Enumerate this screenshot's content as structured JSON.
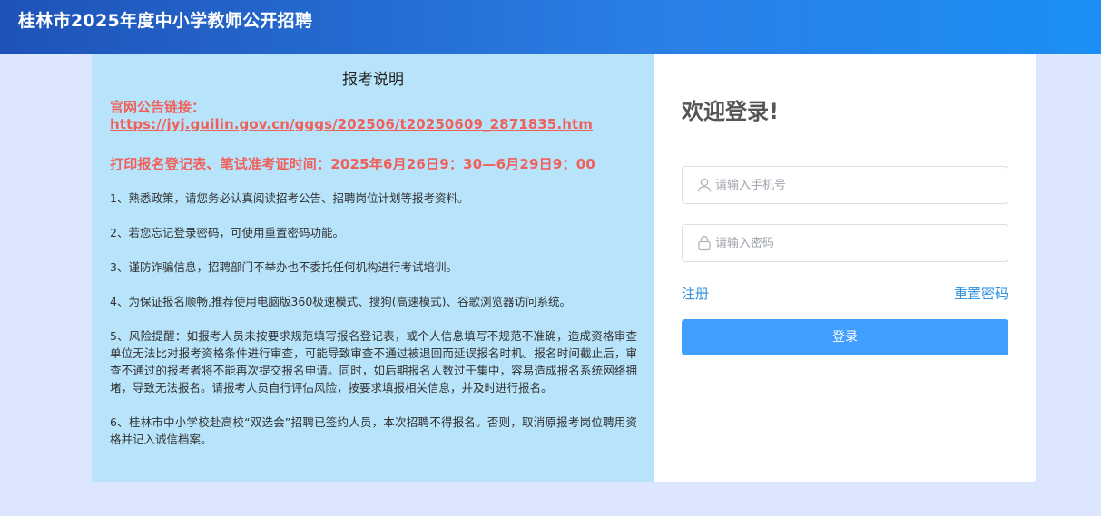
{
  "header": {
    "title": "桂林市2025年度中小学教师公开招聘"
  },
  "notice": {
    "title": "报考说明",
    "link_label": "官网公告链接：",
    "link_url": "https://jyj.guilin.gov.cn/gggs/202506/t20250609_2871835.htm",
    "time": "打印报名登记表、笔试准考证时间：2025年6月26日9：30—6月29日9：00",
    "items": [
      "1、熟悉政策，请您务必认真阅读招考公告、招聘岗位计划等报考资料。",
      "2、若您忘记登录密码，可使用重置密码功能。",
      "3、谨防诈骗信息，招聘部门不举办也不委托任何机构进行考试培训。",
      "4、为保证报名顺畅,推荐使用电脑版360极速模式、搜狗(高速模式)、谷歌浏览器访问系统。",
      "5、风险提醒：如报考人员未按要求规范填写报名登记表，或个人信息填写不规范不准确，造成资格审查单位无法比对报考资格条件进行审查，可能导致审查不通过被退回而延误报名时机。报名时间截止后，审查不通过的报考者将不能再次提交报名申请。同时，如后期报名人数过于集中，容易造成报名系统网络拥堵，导致无法报名。请报考人员自行评估风险，按要求填报相关信息，并及时进行报名。",
      "6、桂林市中小学校赴高校“双选会”招聘已签约人员，本次招聘不得报名。否则，取消原报考岗位聘用资格并记入诚信档案。"
    ],
    "colors": {
      "background": "#b8e4fb",
      "highlight": "#f0605a"
    }
  },
  "login": {
    "title": "欢迎登录!",
    "phone_placeholder": "请输入手机号",
    "password_placeholder": "请输入密码",
    "register_label": "注册",
    "reset_label": "重置密码",
    "submit_label": "登录",
    "icons": {
      "phone": "user-icon",
      "password": "lock-icon"
    },
    "colors": {
      "primary": "#409eff",
      "link": "#2d8fdd"
    }
  }
}
